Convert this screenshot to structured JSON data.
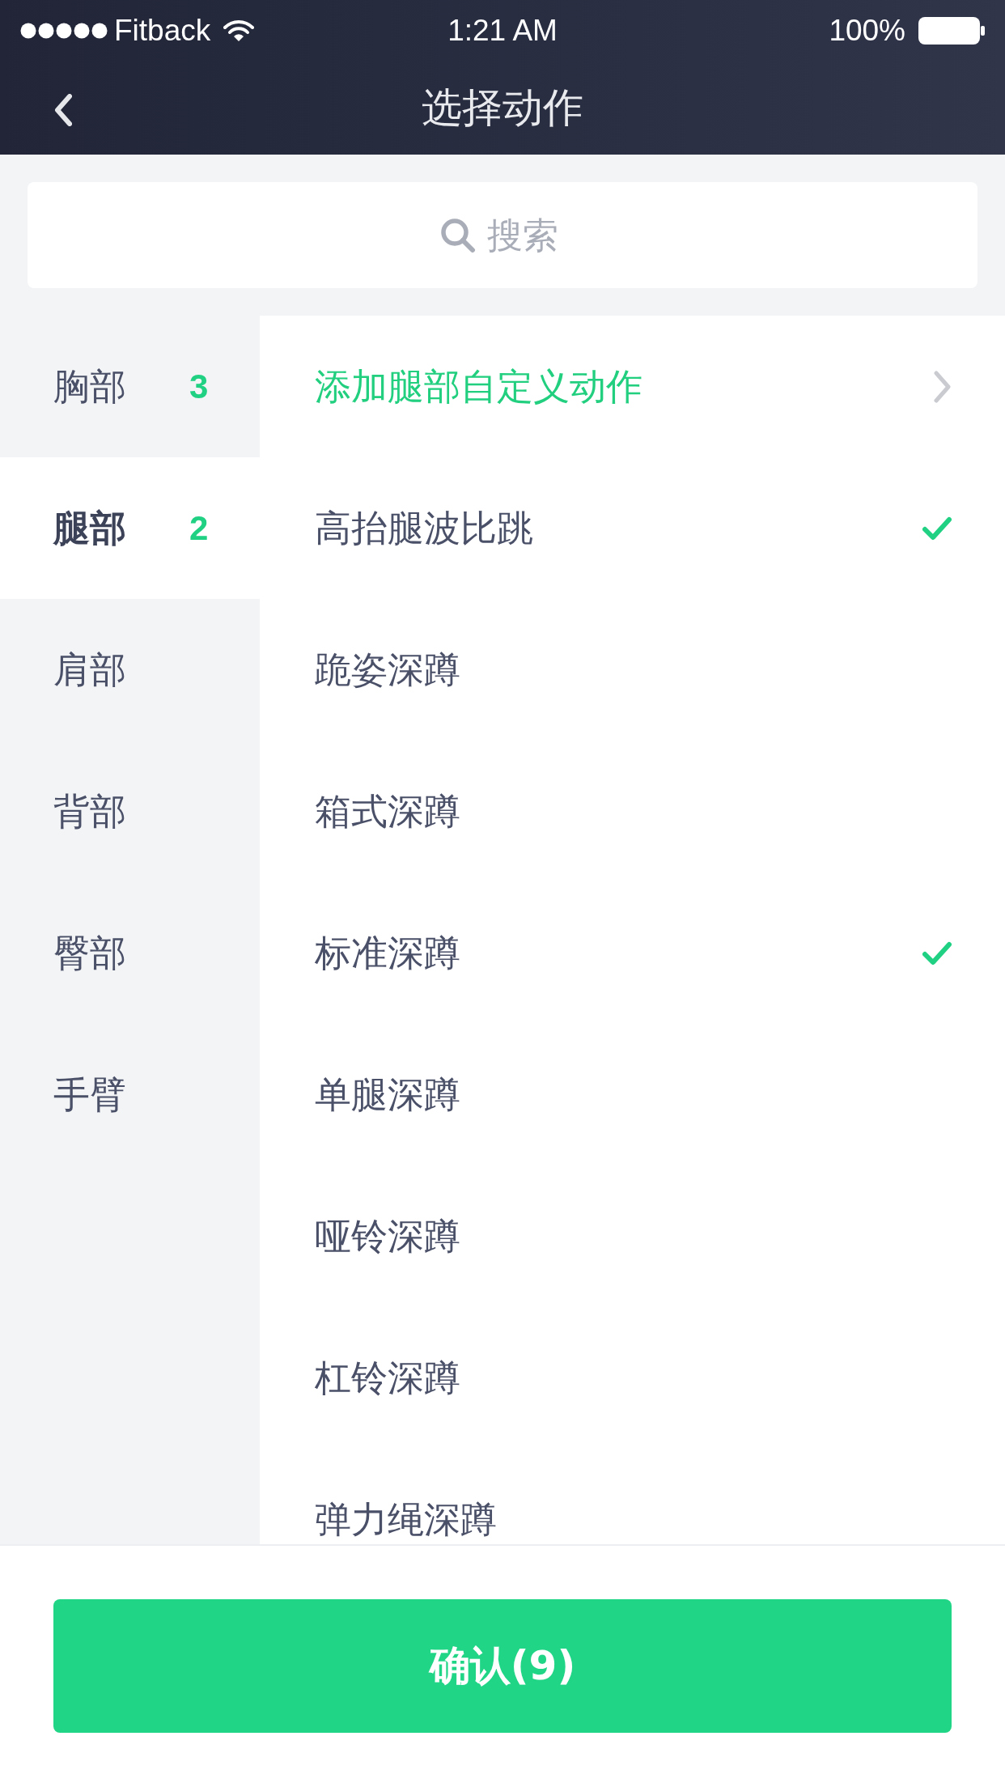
{
  "status_bar": {
    "carrier": "Fitback",
    "time": "1:21 AM",
    "battery": "100%"
  },
  "nav": {
    "title": "选择动作"
  },
  "search": {
    "placeholder": "搜索"
  },
  "categories": [
    {
      "label": "胸部",
      "count": "3",
      "selected": false
    },
    {
      "label": "腿部",
      "count": "2",
      "selected": true
    },
    {
      "label": "肩部",
      "selected": false
    },
    {
      "label": "背部",
      "selected": false
    },
    {
      "label": "臀部",
      "selected": false
    },
    {
      "label": "手臂",
      "selected": false
    }
  ],
  "add_custom": {
    "label": "添加腿部自定义动作"
  },
  "exercises": [
    {
      "label": "高抬腿波比跳",
      "checked": true
    },
    {
      "label": "跪姿深蹲",
      "checked": false
    },
    {
      "label": "箱式深蹲",
      "checked": false
    },
    {
      "label": "标准深蹲",
      "checked": true
    },
    {
      "label": "单腿深蹲",
      "checked": false
    },
    {
      "label": "哑铃深蹲",
      "checked": false
    },
    {
      "label": "杠铃深蹲",
      "checked": false
    },
    {
      "label": "弹力绳深蹲",
      "checked": false
    }
  ],
  "confirm_button": {
    "label": "确认(9)"
  }
}
